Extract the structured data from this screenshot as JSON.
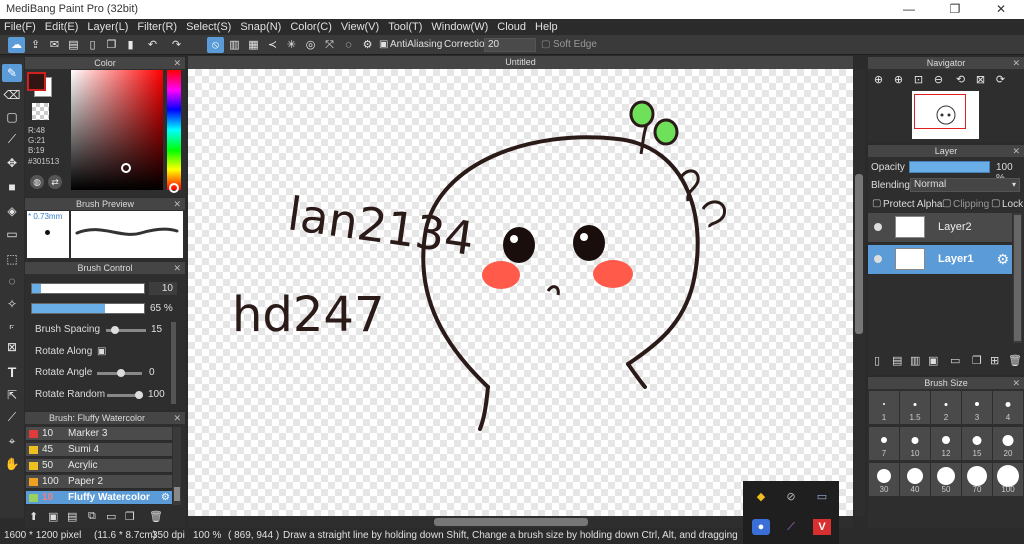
{
  "window": {
    "title": "MediBang Paint Pro (32bit)",
    "min": "—",
    "restore": "❐",
    "close": "✕"
  },
  "menu": [
    "File(F)",
    "Edit(E)",
    "Layer(L)",
    "Filter(R)",
    "Select(S)",
    "Snap(N)",
    "Color(C)",
    "View(V)",
    "Tool(T)",
    "Window(W)",
    "Cloud",
    "Help"
  ],
  "toolbar": {
    "antialiasing_label": "AntiAliasing",
    "correction_label": "Correction",
    "correction_value": "20",
    "soft_edge_label": "Soft Edge"
  },
  "color_panel": {
    "title": "Color",
    "r": "R:48",
    "g": "G:21",
    "b": "B:19",
    "hex": "#301513",
    "foreground": "#301513",
    "background": "#ffffff"
  },
  "brush_preview": {
    "title": "Brush Preview",
    "size": "* 0.73mm"
  },
  "brush_control": {
    "title": "Brush Control",
    "size_value": "10",
    "size_fill": 0.08,
    "opacity_value": "65 %",
    "opacity_fill": 0.65,
    "spacing_label": "Brush Spacing",
    "spacing_value": "15",
    "rotate_along_label": "Rotate Along",
    "rotate_along_mark": "▣",
    "rotate_angle_label": "Rotate Angle",
    "rotate_angle_value": "0",
    "rotate_random_label": "Rotate Random",
    "rotate_random_value": "100"
  },
  "brush_list": {
    "title": "Brush: Fluffy Watercolor",
    "items": [
      {
        "size": "10",
        "name": "Marker 3",
        "color": "#e03a3a"
      },
      {
        "size": "45",
        "name": "Sumi 4",
        "color": "#f0c020"
      },
      {
        "size": "50",
        "name": "Acrylic",
        "color": "#f0c020"
      },
      {
        "size": "100",
        "name": "Paper 2",
        "color": "#f0a020"
      },
      {
        "size": "10",
        "name": "Fluffy Watercolor",
        "color": "#9ad060"
      }
    ]
  },
  "canvas": {
    "tab": "Untitled",
    "text_a": "lan2134",
    "text_b": "hd247"
  },
  "navigator": {
    "title": "Navigator"
  },
  "layer_panel": {
    "title": "Layer",
    "opacity_label": "Opacity",
    "opacity_value": "100 %",
    "blending_label": "Blending",
    "blending_value": "Normal",
    "protect_alpha": "Protect Alpha",
    "clipping": "Clipping",
    "lock": "Lock",
    "layers": [
      {
        "name": "Layer2",
        "selected": false
      },
      {
        "name": "Layer1",
        "selected": true
      }
    ]
  },
  "brush_size": {
    "title": "Brush Size",
    "rows": [
      [
        "1",
        "1.5",
        "2",
        "3",
        "4"
      ],
      [
        "7",
        "10",
        "12",
        "15",
        "20"
      ],
      [
        "30",
        "40",
        "50",
        "70",
        "100"
      ]
    ]
  },
  "status": {
    "dimensions": "1600 * 1200 pixel",
    "physical": "(11.6 * 8.7cm)",
    "dpi": "350 dpi",
    "zoom": "100 %",
    "coords": "( 869, 944 )",
    "hint": "Draw a straight line by holding down Shift, Change a brush size by holding down Ctrl, Alt, and dragging"
  }
}
